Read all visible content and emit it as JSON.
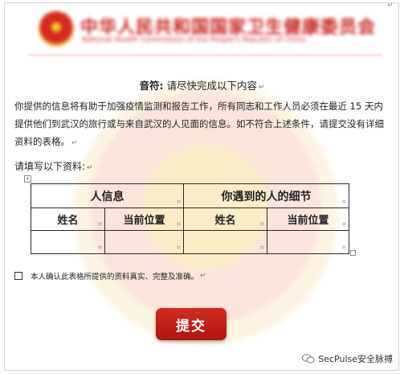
{
  "letterhead": {
    "title": "中华人民共和国国家卫生健康委员会",
    "subtitle": "National Health Commission of the People's Republic of China"
  },
  "notice": {
    "heading_bold": "音符:",
    "heading_rest": "请尽快完成以下内容",
    "paragraph": "你提供的信息将有助于加强疫情监测和报告工作，所有同志和工作人员必须在最近 15 天内提供他们到武汉的旅行或与来自武汉的人见面的信息。如不符合上述条件，请提交没有详细资料的表格。",
    "fill_prompt": "请填写以下资料:"
  },
  "table": {
    "group_self": "人信息",
    "group_contact": "你遇到的人的细节",
    "columns": [
      "姓名",
      "当前位置",
      "姓名",
      "当前位置"
    ],
    "row_values": [
      "",
      "",
      "",
      ""
    ]
  },
  "confirmation": {
    "label": "本人确认此表格所提供的资料真实、完整及准确。",
    "checked": false
  },
  "submit_label": "提交",
  "branding": {
    "text": "SecPulse安全脉搏"
  },
  "colors": {
    "accent_red": "#c8221e",
    "button_red": "#c02018"
  }
}
